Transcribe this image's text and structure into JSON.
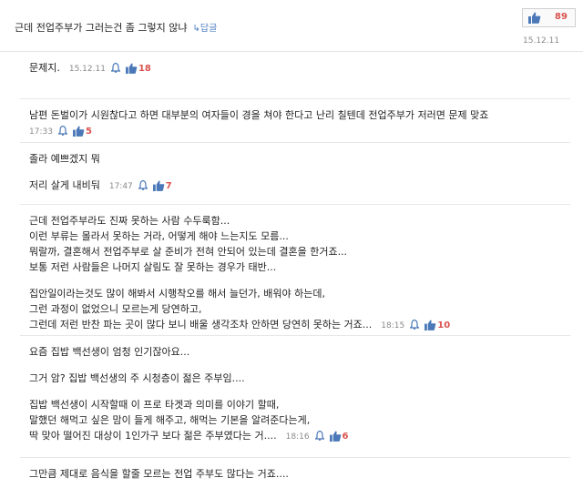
{
  "top_comment": {
    "text": "근데 전업주부가 그러는건 좀 그렇지 않냐",
    "reply_label": "↳답글",
    "likes": "89",
    "date": "15.12.11"
  },
  "replies": [
    {
      "lines": [
        "문제지."
      ],
      "date": "15.12.11",
      "likes": "18"
    },
    {
      "lines": [
        "남편 돈벌이가 시원찮다고 하면 대부분의 여자들이 경을 쳐야 한다고 난리 칠텐데 전업주부가 저러면 문제 맞죠"
      ],
      "date": "17:33",
      "likes": "5"
    },
    {
      "lines": [
        "졸라 예쁘겠지 뭐",
        "",
        "저리 살게 내비둬"
      ],
      "date": "17:47",
      "likes": "7"
    },
    {
      "lines": [
        "근데 전업주부라도 진짜 못하는 사람 수두룩함...",
        "이런 부류는 몰라서 못하는 거라, 어떻게 해야 느는지도 모름...",
        "뭐랄까, 결혼해서 전업주부로 살 준비가 전혀 안되어 있는데 결혼을 한거죠...",
        "보통 저런 사람들은 나머지 살림도 잘 못하는 경우가 태반...",
        "",
        "집안일이라는것도 많이 해봐서 시행착오를 해서 늘던가, 배워야 하는데,",
        "그런 과정이 없었으니 모르는게 당연하고,",
        "그런데 저런 반찬 파는 곳이 많다 보니 배울 생각조차 안하면 당연히 못하는 거죠..."
      ],
      "date": "18:15",
      "likes": "10"
    },
    {
      "lines": [
        "요즘 집밥 백선생이 엄청 인기잖아요...",
        "",
        "그거 암? 집밥 백선생의 주 시청층이 젊은 주부임....",
        "",
        "집밥 백선생이 시작할때 이 프로 타겟과 의미를 이야기 할때,",
        "말했던 해먹고 싶은 맘이 들게 해주고, 해먹는 기본을 알려준다는게,",
        "딱 맞아 떨어진 대상이 1인가구 보다 젊은 주부였다는 거...."
      ],
      "date": "18:16",
      "likes": "6"
    },
    {
      "lines": [
        "그만큼 제대로 음식을 할줄 모르는 전업 주부도 많다는 거죠...."
      ],
      "date": "",
      "likes": ""
    }
  ],
  "colors": {
    "like_count": "#d9534f",
    "thumb": "#4a78b8",
    "reply_link": "#4a7cc0"
  },
  "icons": {
    "like": "thumbs-up-icon",
    "report": "bell-icon"
  }
}
